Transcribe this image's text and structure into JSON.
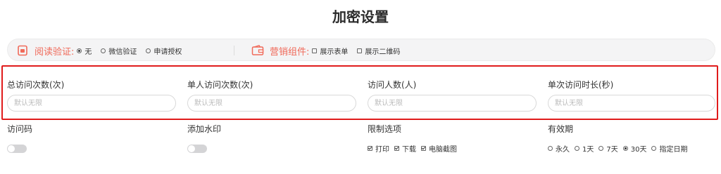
{
  "title": "加密设置",
  "reading_verification": {
    "label": "阅读验证:",
    "icon": "phone-lock-icon",
    "options": [
      "无",
      "微信验证",
      "申请授权"
    ],
    "selected": "无"
  },
  "marketing": {
    "label": "营销组件:",
    "icon": "wallet-icon",
    "options": [
      "展示表单",
      "展示二维码"
    ],
    "checked": []
  },
  "fields": [
    {
      "label": "总访问次数(次)",
      "placeholder": "默认无限"
    },
    {
      "label": "单人访问次数(次)",
      "placeholder": "默认无限"
    },
    {
      "label": "访问人数(人)",
      "placeholder": "默认无限"
    },
    {
      "label": "单次访问时长(秒)",
      "placeholder": "默认无限"
    }
  ],
  "access_code": {
    "label": "访问码",
    "enabled": false
  },
  "watermark": {
    "label": "添加水印",
    "enabled": false
  },
  "restrictions": {
    "label": "限制选项",
    "options": [
      "打印",
      "下载",
      "电脑截图"
    ],
    "checked": [
      "打印",
      "下载",
      "电脑截图"
    ]
  },
  "validity": {
    "label": "有效期",
    "options": [
      "永久",
      "1天",
      "7天",
      "30天",
      "指定日期"
    ],
    "selected": "30天"
  },
  "colors": {
    "accent": "#f06a5a",
    "highlight_border": "#e01b1b",
    "bar_bg": "#f4f4f5"
  }
}
